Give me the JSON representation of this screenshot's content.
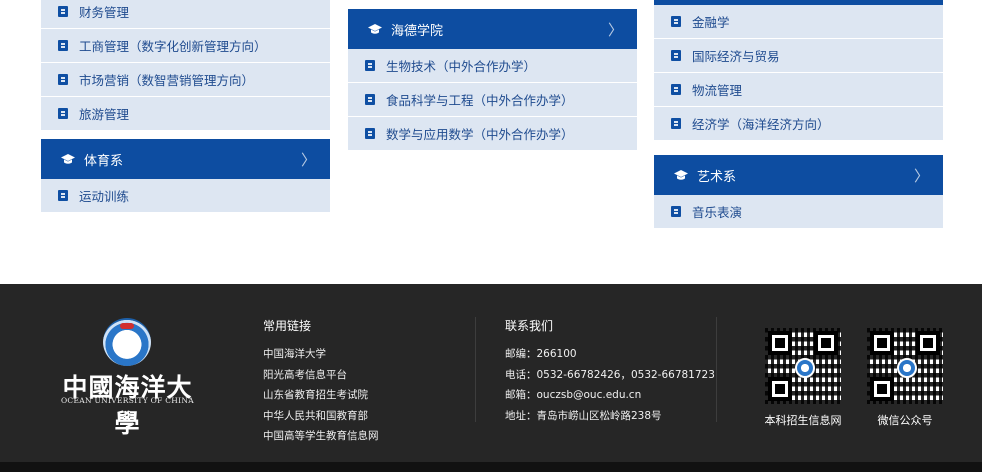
{
  "columns": [
    {
      "panels": [
        {
          "title": "",
          "items": [
            "财务管理",
            "工商管理（数字化创新管理方向）",
            "市场营销（数智营销管理方向）",
            "旅游管理"
          ]
        },
        {
          "title": "体育系",
          "items": [
            "运动训练"
          ]
        }
      ]
    },
    {
      "panels": [
        {
          "title": "海德学院",
          "items": [
            "生物技术（中外合作办学）",
            "食品科学与工程（中外合作办学）",
            "数学与应用数学（中外合作办学）"
          ]
        }
      ]
    },
    {
      "panels": [
        {
          "title": "",
          "items": [
            "金融学",
            "国际经济与贸易",
            "物流管理",
            "经济学（海洋经济方向）"
          ]
        },
        {
          "title": "艺术系",
          "items": [
            "音乐表演"
          ]
        }
      ]
    }
  ],
  "footer": {
    "logo_cn": "中國海洋大學",
    "logo_en": "OCEAN UNIVERSITY OF CHINA",
    "links_title": "常用链接",
    "links": [
      "中国海洋大学",
      "阳光高考信息平台",
      "山东省教育招生考试院",
      "中华人民共和国教育部",
      "中国高等学生教育信息网"
    ],
    "contact_title": "联系我们",
    "contact": [
      "邮编：266100",
      "电话：0532-66782426，0532-66781723",
      "邮箱：ouczsb@ouc.edu.cn",
      "地址：青岛市崂山区松岭路238号"
    ],
    "qr_codes": [
      {
        "label": "本科招生信息网"
      },
      {
        "label": "微信公众号"
      }
    ]
  },
  "colors": {
    "header": "#0d4da1",
    "item_bg": "#dde6f2",
    "item_text": "#1f4b8f",
    "footer_bg": "#262626"
  }
}
